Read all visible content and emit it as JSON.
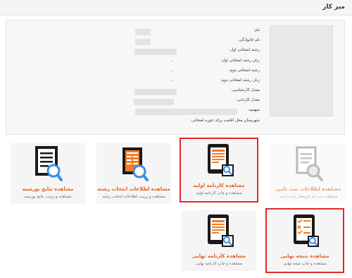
{
  "header": {
    "title": "میز کار"
  },
  "profile": {
    "fields": [
      {
        "label": "نام:",
        "value": ""
      },
      {
        "label": "نام خانوادگی:",
        "value": ""
      },
      {
        "label": "رشته امتحانی اول:",
        "value": ""
      },
      {
        "label": "زبان رشته امتحانی اول:",
        "value": "-"
      },
      {
        "label": "رشته امتحانی دوم:",
        "value": "-"
      },
      {
        "label": "زبان رشته امتحانی دوم:",
        "value": "-"
      },
      {
        "label": "معدل کارشناسی:",
        "value": ""
      },
      {
        "label": "معدل کاردانی:",
        "value": ""
      },
      {
        "label": "سهمیه:",
        "value": ""
      },
      {
        "label": "شهرستان محل اقامت برای حوزه امتحانی:",
        "value": ""
      }
    ]
  },
  "tiles": [
    {
      "title": "مشاهده اطلاعات ثبت نامی",
      "subtitle": "مشاهده ثبت نام غیرفعال شده است",
      "icon": "document-search-icon",
      "enabled": false,
      "highlighted": false
    },
    {
      "title": "مشاهده کارنامه اولیه",
      "subtitle": "مشاهده و چاپ کارنامه اولیه",
      "icon": "tablet-report-search-icon",
      "enabled": true,
      "highlighted": true
    },
    {
      "title": "مشاهده اطلاعات انتخاب رشته",
      "subtitle": "مشاهده و پرینت اطلاعات انتخاب رشته",
      "icon": "table-search-icon",
      "enabled": true,
      "highlighted": false
    },
    {
      "title": "مشاهده نتایج بورسیه",
      "subtitle": "مشاهده و پرینت نتایج بورسیه",
      "icon": "document-search-icon",
      "enabled": true,
      "highlighted": false
    },
    {
      "title": "مشاهده نتیجه نهایی",
      "subtitle": "مشاهده و چاپ نتیجه نهایی",
      "icon": "checklist-search-icon",
      "enabled": true,
      "highlighted": true
    },
    {
      "title": "مشاهده کارنامه نهایی",
      "subtitle": "مشاهده و چاپ کارنامه نهایی",
      "icon": "tablet-report-search-icon",
      "enabled": true,
      "highlighted": false
    }
  ],
  "colors": {
    "accent": "#e4601f",
    "highlight": "#e02428",
    "icon_dark": "#1a1a1a",
    "icon_blue": "#3a8ee6"
  }
}
